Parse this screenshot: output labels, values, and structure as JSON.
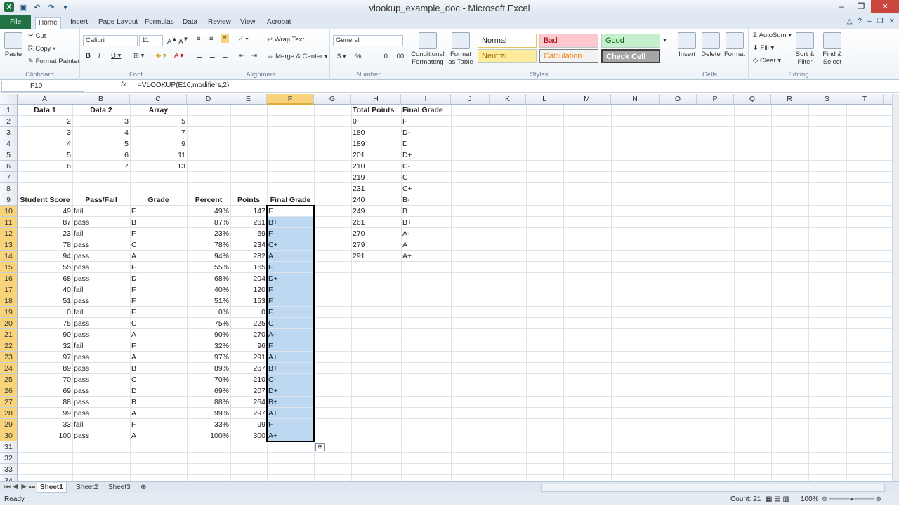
{
  "window": {
    "title": "vlookup_example_doc - Microsoft Excel"
  },
  "tabs": [
    "File",
    "Home",
    "Insert",
    "Page Layout",
    "Formulas",
    "Data",
    "Review",
    "View",
    "Acrobat"
  ],
  "ribbon": {
    "clipboard": {
      "paste": "Paste",
      "cut": "Cut",
      "copy": "Copy",
      "format_painter": "Format Painter",
      "label": "Clipboard"
    },
    "font": {
      "name": "Calibri",
      "size": "11",
      "label": "Font"
    },
    "alignment": {
      "wrap": "Wrap Text",
      "merge": "Merge & Center",
      "label": "Alignment"
    },
    "number": {
      "format": "General",
      "label": "Number"
    },
    "styles": {
      "conditional": "Conditional Formatting",
      "format_table": "Format as Table",
      "normal": "Normal",
      "bad": "Bad",
      "good": "Good",
      "neutral": "Neutral",
      "calculation": "Calculation",
      "check": "Check Cell",
      "label": "Styles"
    },
    "cells": {
      "insert": "Insert",
      "delete": "Delete",
      "format": "Format",
      "label": "Cells"
    },
    "editing": {
      "autosum": "AutoSum",
      "fill": "Fill",
      "clear": "Clear",
      "sort": "Sort & Filter",
      "find": "Find & Select",
      "label": "Editing"
    }
  },
  "formula_bar": {
    "name_box": "F10",
    "fx": "fx",
    "formula": "=VLOOKUP(E10,modifiers,2)"
  },
  "columns": [
    "A",
    "B",
    "C",
    "D",
    "E",
    "F",
    "G",
    "H",
    "I",
    "J",
    "K",
    "L",
    "M",
    "N",
    "O",
    "P",
    "Q",
    "R",
    "S",
    "T"
  ],
  "cells": {
    "A1": "Data 1",
    "B1": "Data 2",
    "C1": "Array",
    "H1": "Total Points",
    "I1": "Final Grade",
    "A2": "2",
    "B2": "3",
    "C2": "5",
    "H2": "0",
    "I2": "F",
    "A3": "3",
    "B3": "4",
    "C3": "7",
    "H3": "180",
    "I3": "D-",
    "A4": "4",
    "B4": "5",
    "C4": "9",
    "H4": "189",
    "I4": "D",
    "A5": "5",
    "B5": "6",
    "C5": "11",
    "H5": "201",
    "I5": "D+",
    "A6": "6",
    "B6": "7",
    "C6": "13",
    "H6": "210",
    "I6": "C-",
    "H7": "219",
    "I7": "C",
    "H8": "231",
    "I8": "C+",
    "A9": "Student Score",
    "B9": "Pass/Fail",
    "C9": "Grade",
    "D9": "Percent",
    "E9": "Points",
    "F9": "Final Grade",
    "H9": "240",
    "I9": "B-",
    "H10": "249",
    "I10": "B",
    "H11": "261",
    "I11": "B+",
    "H12": "270",
    "I12": "A-",
    "H13": "279",
    "I13": "A",
    "H14": "291",
    "I14": "A+"
  },
  "students": [
    {
      "score": "49",
      "pf": "fail",
      "grade": "F",
      "pct": "49%",
      "pts": "147",
      "final": "F"
    },
    {
      "score": "87",
      "pf": "pass",
      "grade": "B",
      "pct": "87%",
      "pts": "261",
      "final": "B+"
    },
    {
      "score": "23",
      "pf": "fail",
      "grade": "F",
      "pct": "23%",
      "pts": "69",
      "final": "F"
    },
    {
      "score": "78",
      "pf": "pass",
      "grade": "C",
      "pct": "78%",
      "pts": "234",
      "final": "C+"
    },
    {
      "score": "94",
      "pf": "pass",
      "grade": "A",
      "pct": "94%",
      "pts": "282",
      "final": "A"
    },
    {
      "score": "55",
      "pf": "pass",
      "grade": "F",
      "pct": "55%",
      "pts": "165",
      "final": "F"
    },
    {
      "score": "68",
      "pf": "pass",
      "grade": "D",
      "pct": "68%",
      "pts": "204",
      "final": "D+"
    },
    {
      "score": "40",
      "pf": "fail",
      "grade": "F",
      "pct": "40%",
      "pts": "120",
      "final": "F"
    },
    {
      "score": "51",
      "pf": "pass",
      "grade": "F",
      "pct": "51%",
      "pts": "153",
      "final": "F"
    },
    {
      "score": "0",
      "pf": "fail",
      "grade": "F",
      "pct": "0%",
      "pts": "0",
      "final": "F"
    },
    {
      "score": "75",
      "pf": "pass",
      "grade": "C",
      "pct": "75%",
      "pts": "225",
      "final": "C"
    },
    {
      "score": "90",
      "pf": "pass",
      "grade": "A",
      "pct": "90%",
      "pts": "270",
      "final": "A-"
    },
    {
      "score": "32",
      "pf": "fail",
      "grade": "F",
      "pct": "32%",
      "pts": "96",
      "final": "F"
    },
    {
      "score": "97",
      "pf": "pass",
      "grade": "A",
      "pct": "97%",
      "pts": "291",
      "final": "A+"
    },
    {
      "score": "89",
      "pf": "pass",
      "grade": "B",
      "pct": "89%",
      "pts": "267",
      "final": "B+"
    },
    {
      "score": "70",
      "pf": "pass",
      "grade": "C",
      "pct": "70%",
      "pts": "210",
      "final": "C-"
    },
    {
      "score": "69",
      "pf": "pass",
      "grade": "D",
      "pct": "69%",
      "pts": "207",
      "final": "D+"
    },
    {
      "score": "88",
      "pf": "pass",
      "grade": "B",
      "pct": "88%",
      "pts": "264",
      "final": "B+"
    },
    {
      "score": "99",
      "pf": "pass",
      "grade": "A",
      "pct": "99%",
      "pts": "297",
      "final": "A+"
    },
    {
      "score": "33",
      "pf": "fail",
      "grade": "F",
      "pct": "33%",
      "pts": "99",
      "final": "F"
    },
    {
      "score": "100",
      "pf": "pass",
      "grade": "A",
      "pct": "100%",
      "pts": "300",
      "final": "A+"
    }
  ],
  "sheets": [
    "Sheet1",
    "Sheet2",
    "Sheet3"
  ],
  "status": {
    "ready": "Ready",
    "count": "Count: 21",
    "zoom": "100%"
  },
  "colors": {
    "accent": "#217346",
    "selection": "#bcd8f0",
    "header_sel": "#f8d37a"
  }
}
